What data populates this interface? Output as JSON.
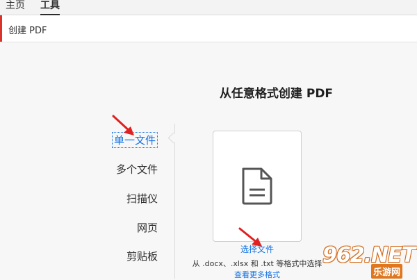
{
  "topbar": {
    "tabs": [
      {
        "label": "主页"
      },
      {
        "label": "工具"
      }
    ]
  },
  "toolbar": {
    "title": "创建 PDF"
  },
  "heading": "从任意格式创建 PDF",
  "options": [
    {
      "label": "单一文件",
      "selected": true
    },
    {
      "label": "多个文件"
    },
    {
      "label": "扫描仪"
    },
    {
      "label": "网页"
    },
    {
      "label": "剪贴板"
    }
  ],
  "dropzone": {
    "icon": "document-icon",
    "choose_label": "选择文件",
    "formats_text": "从 .docx、.xlsx 和 .txt 等格式中选择",
    "more_label": "查看更多格式"
  },
  "watermark": {
    "main": "962.NET",
    "sub": "乐游网"
  },
  "colors": {
    "accent": "#d9342b",
    "link": "#1473e6",
    "annotation": "#e02020"
  }
}
